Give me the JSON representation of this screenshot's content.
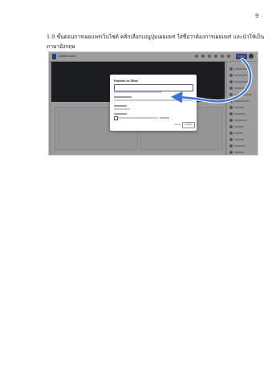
{
  "page_number": "9",
  "instruction": {
    "line1": "1.9 ขั้นตอนการเผยแพร่เว็บไซต์ คลิกเลือกเมนูปุ่มเผยแพร่ ใส่ชื่อว่าต้องการเผยแพร่ และนำให้เป็น",
    "line2": "ภาษาอังกฤษ"
  },
  "screenshot": {
    "app_title": "Untitled site",
    "publish_button": "Publish",
    "dialog": {
      "title": "Publish to Sites",
      "web_address": "",
      "cancel_label": "Cancel",
      "publish_label": "Publish"
    }
  },
  "colors": {
    "accent": "#3e5ecf",
    "arrow": "#3a74d8"
  }
}
